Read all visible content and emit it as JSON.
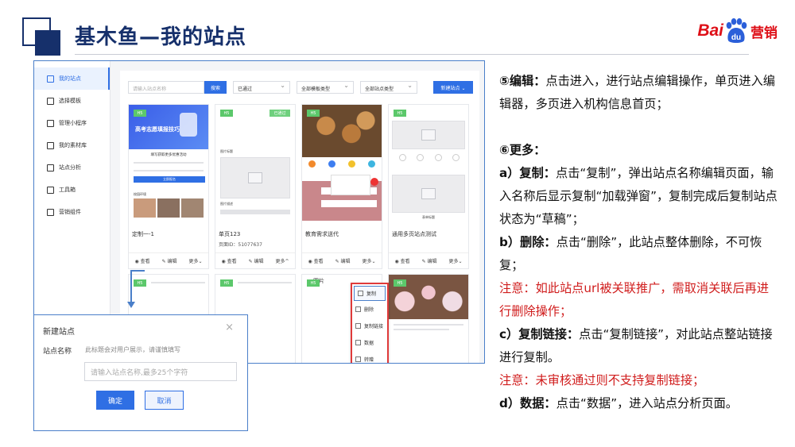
{
  "slide": {
    "title": "基木鱼—我的站点",
    "logo_text_left": "Bai",
    "logo_text_paw": "du",
    "logo_text_right": "营销"
  },
  "sidebar": {
    "items": [
      {
        "label": "我的站点",
        "icon": "site-icon",
        "active": true
      },
      {
        "label": "选择模板",
        "icon": "template-icon"
      },
      {
        "label": "管理小程序",
        "icon": "miniapp-icon"
      },
      {
        "label": "我的素材库",
        "icon": "image-icon"
      },
      {
        "label": "站点分析",
        "icon": "chart-icon"
      },
      {
        "label": "工具箱",
        "icon": "toolbox-icon"
      },
      {
        "label": "营销组件",
        "icon": "component-icon"
      }
    ]
  },
  "toolbar": {
    "search_placeholder": "请输入站点名称",
    "search_button": "搜索",
    "filter_status": "已通过",
    "filter_template": "全部模板类型",
    "filter_site": "全部站点类型",
    "new_site_button": "新建站点 ⌄"
  },
  "cards": [
    {
      "badge": "H5",
      "name": "定制一-1",
      "id": "",
      "thumb_banner": "高考志愿填报技巧",
      "thumb_caption": "填写获取更多优惠活动",
      "thumb_button": "立即报名",
      "thumb_section": "校园环境"
    },
    {
      "badge": "H5",
      "badge2": "已通过",
      "name": "单页123",
      "id": "页面ID：51077637",
      "thumb_label_top": "图片标题",
      "thumb_label_bottom": "图片描述"
    },
    {
      "badge": "H5",
      "name": "教育需求送代",
      "id": ""
    },
    {
      "badge": "H5",
      "name": "通用多页站点测试",
      "id": "",
      "thumb_label": "表单标题"
    }
  ],
  "card_actions": {
    "view": "查看",
    "edit": "编辑",
    "more": "更多"
  },
  "row2": [
    {
      "badge": "H5"
    },
    {
      "badge": "H5"
    },
    {
      "badge": "H5",
      "title": "图片"
    },
    {
      "badge": "H5"
    }
  ],
  "more_menu": {
    "items": [
      "复制",
      "删除",
      "复制链接",
      "数据",
      "转赠"
    ]
  },
  "modal": {
    "title": "新建站点",
    "label": "站点名称",
    "hint": "此标题会对用户展示，请谨慎填写",
    "placeholder": "请输入站点名称,最多25个字符",
    "ok": "确定",
    "cancel": "取消"
  },
  "notes": {
    "edit_title": "⑤编辑：",
    "edit_body": "点击进入，进行站点编辑操作，单页进入编辑器，多页进入机构信息首页；",
    "more_title": "⑥更多：",
    "copy_title": "a）复制：",
    "copy_body": "点击“复制”，弹出站点名称编辑页面，输入名称后显示复制“加载弹窗”，复制完成后复制站点状态为“草稿”；",
    "delete_title": "b）删除：",
    "delete_body": "点击“删除”，此站点整体删除，不可恢复；",
    "delete_warning": "注意：如此站点url被关联推广，需取消关联后再进行删除操作；",
    "link_title": "c）复制链接：",
    "link_body": "点击“复制链接”，对此站点整站链接进行复制。",
    "link_warning": "注意：未审核通过则不支持复制链接；",
    "data_title": "d）数据：",
    "data_body": "点击“数据”，进入站点分析页面。"
  },
  "colors": {
    "brand_blue": "#16306b",
    "accent_blue": "#2f6fe4",
    "warning_red": "#d01c1c",
    "baidu_red": "#de0f17"
  }
}
